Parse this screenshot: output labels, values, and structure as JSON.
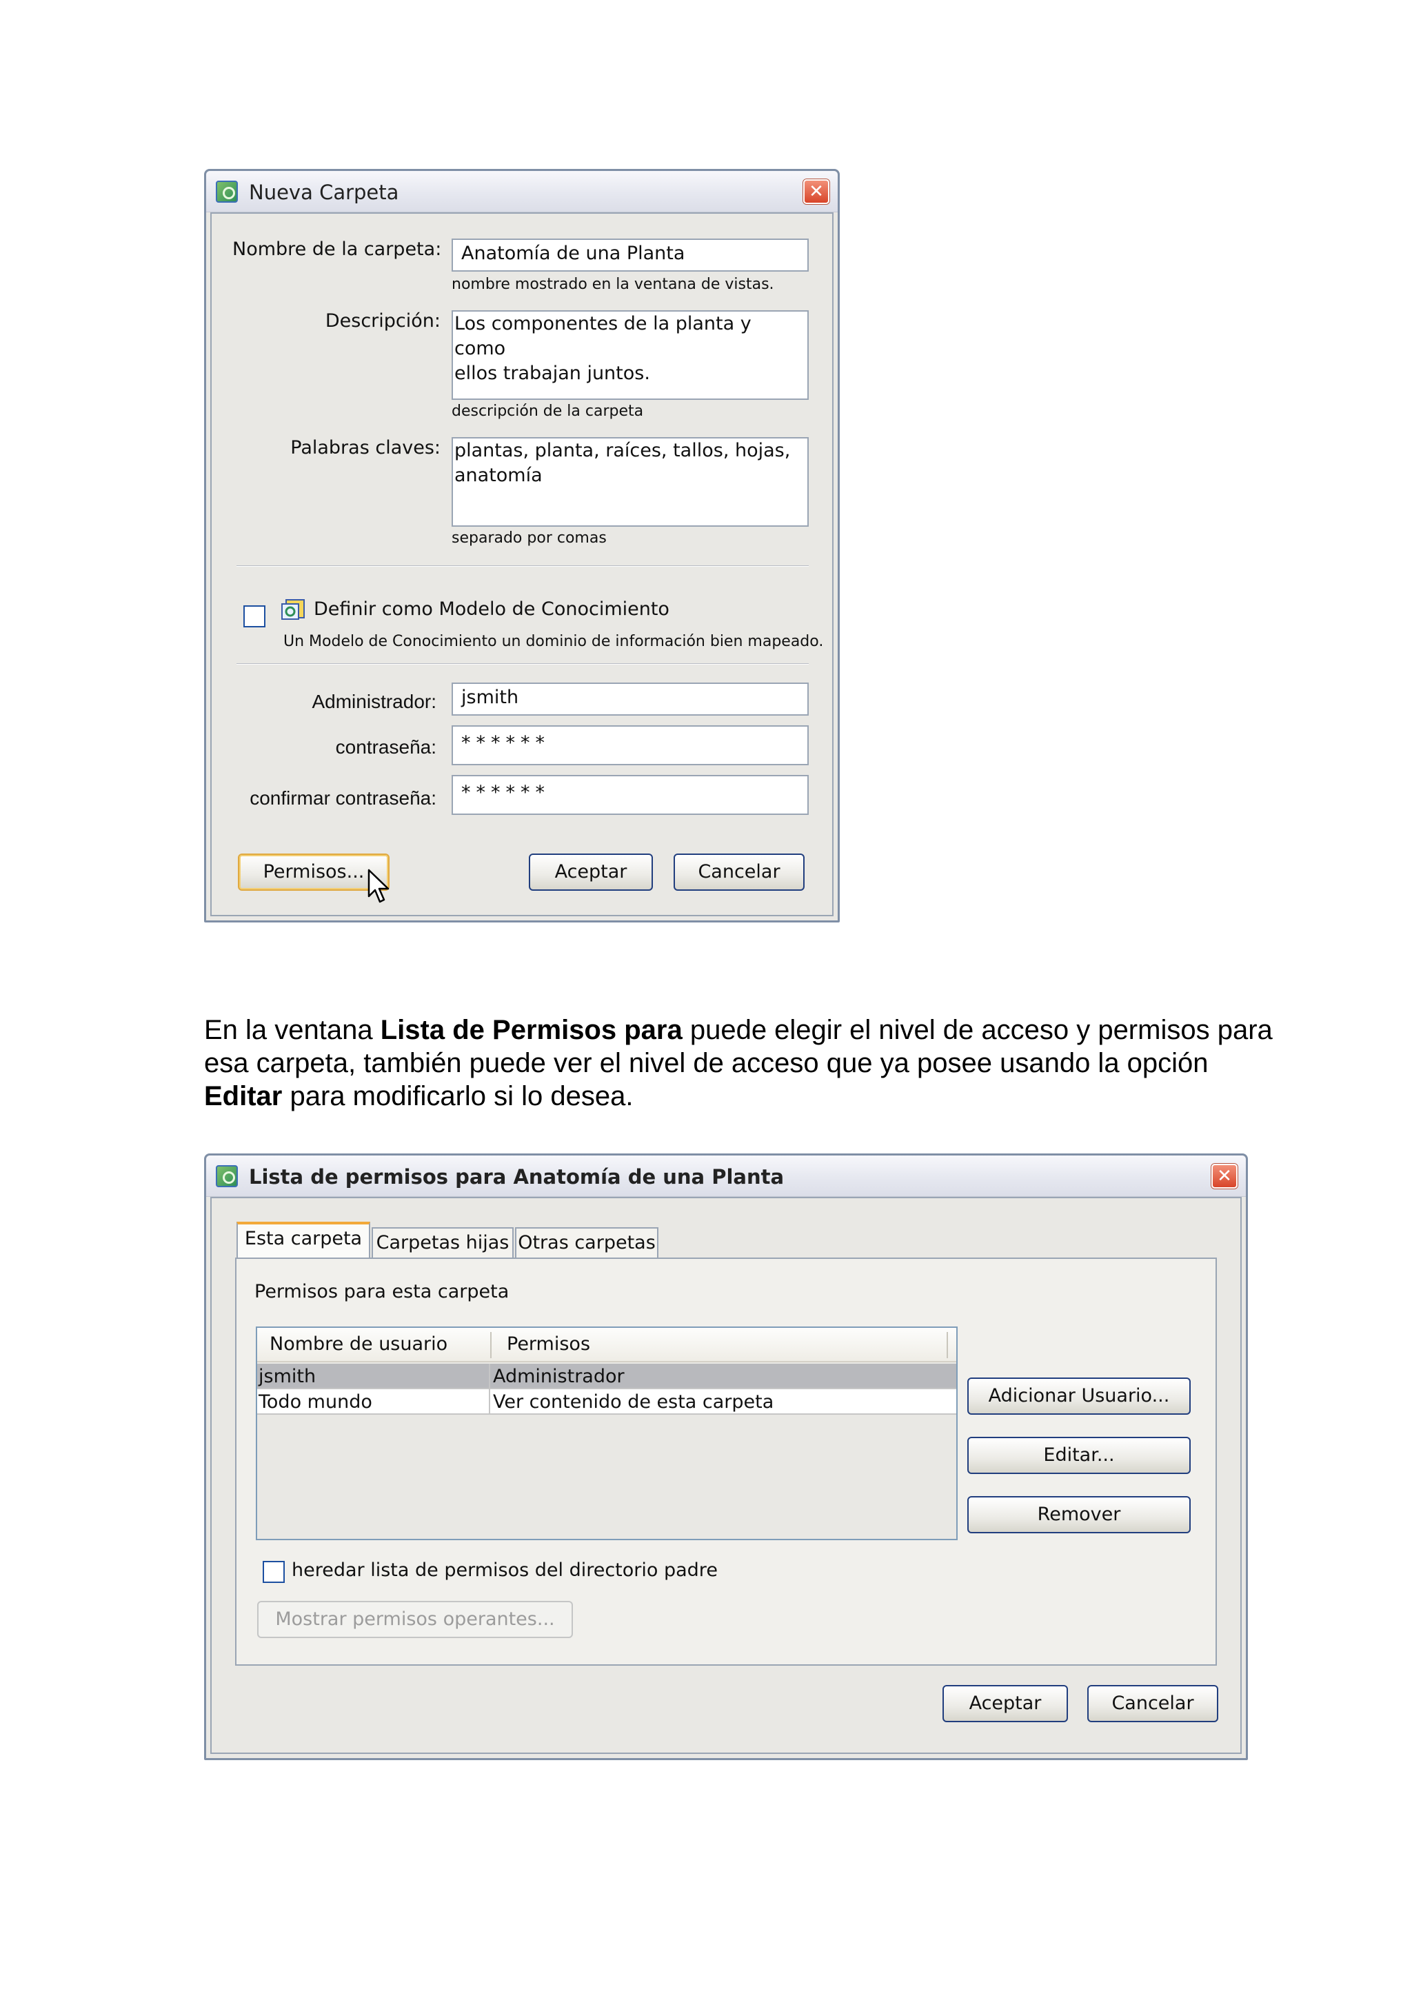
{
  "dialog1": {
    "title": "Nueva Carpeta",
    "close": "✕",
    "name_label": "Nombre de la carpeta:",
    "name_value": "Anatomía de una Planta",
    "name_hint": "nombre mostrado en la ventana de vistas.",
    "desc_label": "Descripción:",
    "desc_value": "Los componentes de la planta y como\nellos trabajan juntos.",
    "desc_hint": "descripción de la carpeta",
    "keywords_label": "Palabras claves:",
    "keywords_value": "plantas, planta, raíces, tallos, hojas,\nanatomía",
    "keywords_hint": "separado por comas",
    "km_checkbox_label": "Definir como Modelo de Conocimiento",
    "km_checkbox_checked": false,
    "km_hint": "Un Modelo de Conocimiento un dominio de información bien mapeado.",
    "admin_label": "Administrador:",
    "admin_value": "jsmith",
    "password_label": "contraseña:",
    "password_value": "******",
    "confirm_label": "confirmar contraseña:",
    "confirm_value": "******",
    "permisos_button": "Permisos...",
    "accept_button": "Aceptar",
    "cancel_button": "Cancelar"
  },
  "paragraph": {
    "part1": "En la ventana ",
    "bold1": "Lista de Permisos para",
    "part2": " puede elegir el nivel de acceso y permisos para esa carpeta, también puede ver el nivel de acceso que ya posee usando la opción ",
    "bold2": "Editar",
    "part3": " para modificarlo si lo desea."
  },
  "dialog2": {
    "title": "Lista de permisos para Anatomía de una Planta",
    "close": "✕",
    "tabs": [
      "Esta carpeta",
      "Carpetas hijas",
      "Otras carpetas"
    ],
    "active_tab": "Esta carpeta",
    "panel_title": "Permisos para esta carpeta",
    "columns": [
      "Nombre de usuario",
      "Permisos"
    ],
    "rows": [
      {
        "user": "jsmith",
        "permission": "Administrador",
        "selected": true
      },
      {
        "user": "Todo mundo",
        "permission": "Ver contenido de esta carpeta",
        "selected": false
      }
    ],
    "add_user_button": "Adicionar Usuario...",
    "edit_button": "Editar...",
    "remove_button": "Remover",
    "inherit_label": "heredar lista de permisos del directorio padre",
    "inherit_checked": false,
    "show_effective_button": "Mostrar permisos operantes...",
    "accept_button": "Aceptar",
    "cancel_button": "Cancelar"
  },
  "colors": {
    "window_border": "#7f8fa6",
    "button_border": "#213e7e",
    "focus_ring": "#e0a940",
    "close_button": "#d8452a",
    "active_tab_accent": "#f2a93a",
    "selected_row": "#b8b9bd"
  }
}
